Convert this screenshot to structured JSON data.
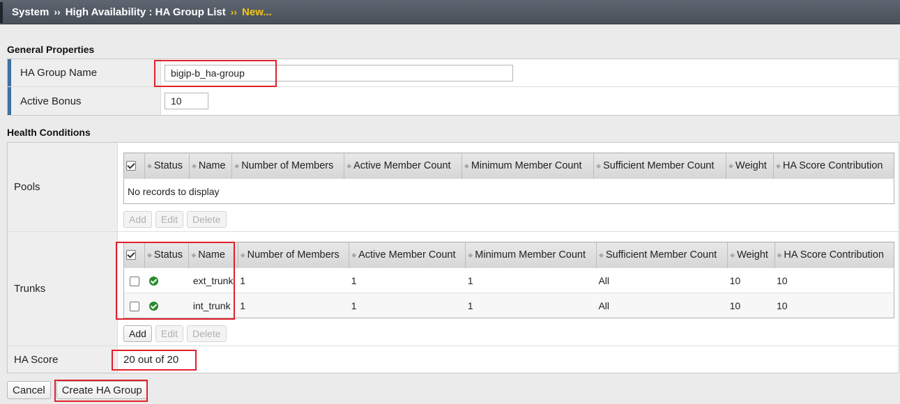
{
  "breadcrumb": {
    "items": [
      "System",
      "High Availability : HA Group List"
    ],
    "separator": "››",
    "current": "New..."
  },
  "general": {
    "title": "General Properties",
    "ha_group_name_label": "HA Group Name",
    "ha_group_name_value": "bigip-b_ha-group",
    "active_bonus_label": "Active Bonus",
    "active_bonus_value": "10"
  },
  "health": {
    "title": "Health Conditions",
    "pools": {
      "label": "Pools",
      "columns": [
        "Status",
        "Name",
        "Number of Members",
        "Active Member Count",
        "Minimum Member Count",
        "Sufficient Member Count",
        "Weight",
        "HA Score Contribution"
      ],
      "empty_text": "No records to display",
      "buttons": {
        "add": "Add",
        "edit": "Edit",
        "delete": "Delete"
      }
    },
    "trunks": {
      "label": "Trunks",
      "columns": [
        "Status",
        "Name",
        "Number of Members",
        "Active Member Count",
        "Minimum Member Count",
        "Sufficient Member Count",
        "Weight",
        "HA Score Contribution"
      ],
      "rows": [
        {
          "status": "ok",
          "name": "ext_trunk",
          "members": "1",
          "active": "1",
          "minimum": "1",
          "sufficient": "All",
          "weight": "10",
          "contribution": "10"
        },
        {
          "status": "ok",
          "name": "int_trunk",
          "members": "1",
          "active": "1",
          "minimum": "1",
          "sufficient": "All",
          "weight": "10",
          "contribution": "10"
        }
      ],
      "buttons": {
        "add": "Add",
        "edit": "Edit",
        "delete": "Delete"
      }
    },
    "ha_score": {
      "label": "HA Score",
      "value": "20 out of 20"
    }
  },
  "actions": {
    "cancel": "Cancel",
    "create": "Create HA Group"
  },
  "colors": {
    "highlight": "#e0202a",
    "status_ok": "#2a8a2f",
    "breadcrumb_current": "#f5c417"
  }
}
